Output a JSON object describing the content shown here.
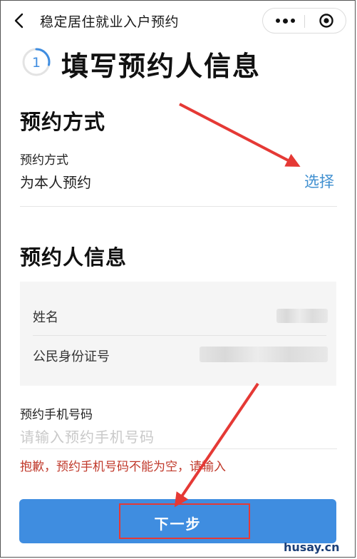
{
  "header": {
    "title": "稳定居住就业入户预约"
  },
  "step": {
    "number": "1",
    "title": "填写预约人信息"
  },
  "booking_method": {
    "section_title": "预约方式",
    "field_label": "预约方式",
    "field_value": "为本人预约",
    "select_label": "选择"
  },
  "booker_info": {
    "section_title": "预约人信息",
    "name_label": "姓名",
    "id_label": "公民身份证号"
  },
  "phone": {
    "label": "预约手机号码",
    "placeholder": "请输入预约手机号码",
    "error": "抱歉，预约手机号码不能为空，请输入"
  },
  "next_button": {
    "label": "下一步"
  },
  "watermark": "husay.cn",
  "colors": {
    "accent": "#3f8de0",
    "link": "#3f8fd0",
    "error": "#c0392b",
    "annotation": "#e53935"
  }
}
